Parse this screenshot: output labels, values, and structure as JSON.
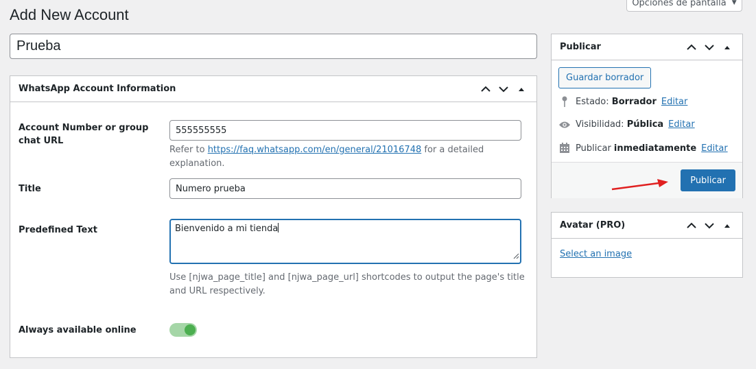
{
  "page": {
    "title": "Add New Account",
    "screen_options": "Opciones de pantalla",
    "post_title_value": "Prueba"
  },
  "whatsapp_box": {
    "title": "WhatsApp Account Information",
    "fields": {
      "account": {
        "label": "Account Number or group chat URL",
        "value": "555555555",
        "help_prefix": "Refer to ",
        "help_link": "https://faq.whatsapp.com/en/general/21016748",
        "help_suffix": " for a detailed explanation."
      },
      "title": {
        "label": "Title",
        "value": "Numero prueba"
      },
      "predefined": {
        "label": "Predefined Text",
        "value": "Bienvenido a mi tienda",
        "help": "Use [njwa_page_title] and [njwa_page_url] shortcodes to output the page's title and URL respectively."
      },
      "online": {
        "label": "Always available online",
        "enabled": true
      }
    }
  },
  "publish_box": {
    "title": "Publicar",
    "save_draft": "Guardar borrador",
    "status_label": "Estado: ",
    "status_value": "Borrador",
    "visibility_label": "Visibilidad: ",
    "visibility_value": "Pública",
    "schedule_label": "Publicar ",
    "schedule_value": "inmediatamente",
    "edit": "Editar",
    "publish": "Publicar"
  },
  "avatar_box": {
    "title": "Avatar (PRO)",
    "select_image": "Select an image"
  },
  "colors": {
    "accent": "#2271b1",
    "toggle_on": "#4caf50",
    "annotation_arrow": "#e02020"
  }
}
